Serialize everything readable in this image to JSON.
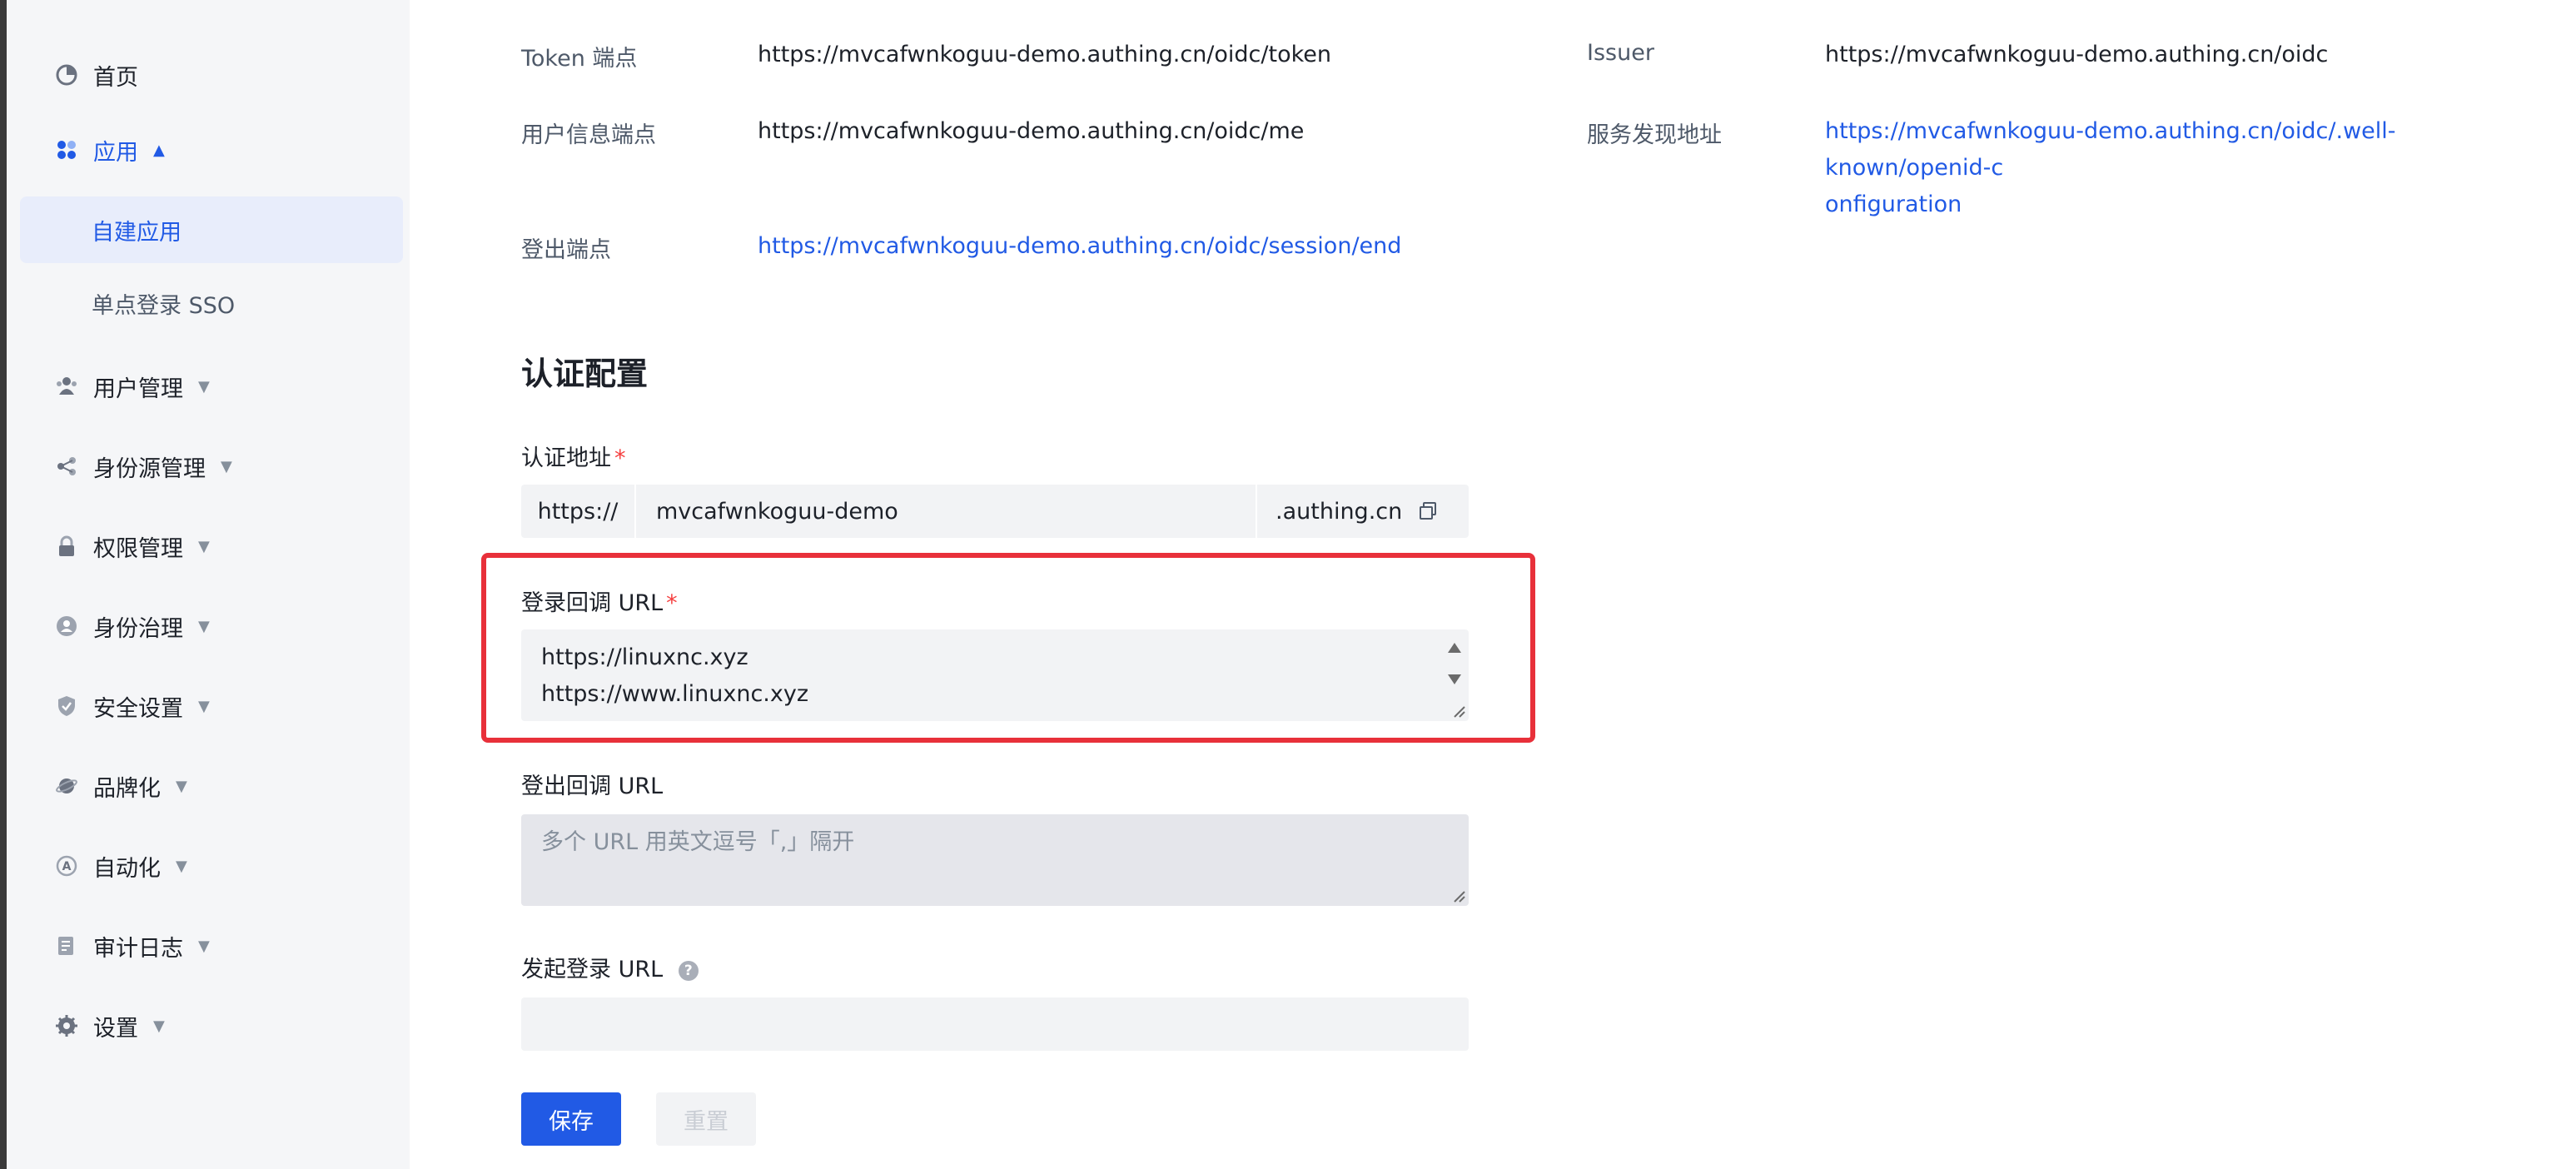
{
  "sidebar": {
    "items": [
      {
        "label": "首页",
        "icon": "pie-chart-icon"
      },
      {
        "label": "应用",
        "icon": "apps-icon",
        "expanded": true
      },
      {
        "label": "自建应用",
        "selected": true
      },
      {
        "label": "单点登录 SSO"
      },
      {
        "label": "用户管理",
        "icon": "users-icon"
      },
      {
        "label": "身份源管理",
        "icon": "share-icon"
      },
      {
        "label": "权限管理",
        "icon": "lock-icon"
      },
      {
        "label": "身份治理",
        "icon": "identity-icon"
      },
      {
        "label": "安全设置",
        "icon": "shield-icon"
      },
      {
        "label": "品牌化",
        "icon": "planet-icon"
      },
      {
        "label": "自动化",
        "icon": "automation-icon"
      },
      {
        "label": "审计日志",
        "icon": "log-icon"
      },
      {
        "label": "设置",
        "icon": "gear-icon"
      }
    ],
    "accent_color": "#215ae5"
  },
  "endpoints": {
    "token_label": "Token 端点",
    "token_value": "https://mvcafwnkoguu-demo.authing.cn/oidc/token",
    "issuer_label": "Issuer",
    "issuer_value": "https://mvcafwnkoguu-demo.authing.cn/oidc",
    "userinfo_label": "用户信息端点",
    "userinfo_value": "https://mvcafwnkoguu-demo.authing.cn/oidc/me",
    "discovery_label": "服务发现地址",
    "discovery_value_line1": "https://mvcafwnkoguu-demo.authing.cn/oidc/.well-known/openid-c",
    "discovery_value_line2": "onfiguration",
    "logout_label": "登出端点",
    "logout_value": "https://mvcafwnkoguu-demo.authing.cn/oidc/session/end"
  },
  "auth_config": {
    "title": "认证配置",
    "address_label": "认证地址",
    "required_mark": "*",
    "address_prefix": "https://",
    "address_value": "mvcafwnkoguu-demo",
    "address_suffix": ".authing.cn",
    "callback_label": "登录回调 URL",
    "callback_line1": "https://linuxnc.xyz",
    "callback_line2": "https://www.linuxnc.xyz",
    "logout_callback_label": "登出回调 URL",
    "logout_callback_placeholder": "多个 URL 用英文逗号「,」隔开",
    "initiate_login_label": "发起登录 URL",
    "help_glyph": "?",
    "save_label": "保存",
    "reset_label": "重置"
  },
  "highlight_color": "#e8303a"
}
